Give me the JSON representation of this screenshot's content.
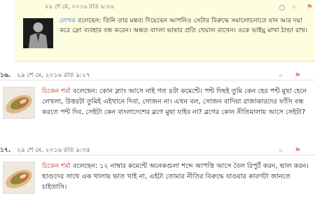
{
  "comments": [
    {
      "date": "২৯ শে মে, ২০১৬ রাত ৯:২৬",
      "author": "লেখক",
      "said": "বলেছেন:",
      "text": "তিনি তার মন্তব্য দিয়েছেন আপনিও সেটার বিরুদ্ধে সমালোচনাতে যান আর দয়া করে স্লেং ব্যবহার বন্ধ করেন। অন্তত বাংলা ভাষার প্রতি খেয়াল রাখেন। ওকে ভাইয়ু মাথা ঠান্ডা রাখ।",
      "votes": "০"
    },
    {
      "num": "১৬.",
      "date": "২৯ শে মে, ২০১৬ রাত ৯:২৭",
      "author": "চিকেন শর্মা",
      "said": "বলেছেন:",
      "text": "কোন স্ল্যাং আসে নাই গত ৪টা কমেন্টে। পন্ট দিছই তুমি কেন হের পন্ট মুছা হেনে লেখলা, উত্তরটা তুমিই এইখানে দিবা, সোজন না। এখন বল, সোজন বাদিয়া রাজাকারদের ফাঁসি বন্ধ করতে পন্ট দিব, সেইটা কেন বাংলাদেশের ব্লগে মুছা যাইব না? ব্লগের কোন নীতিমালায় আসে সেইটা?",
      "votes": "০"
    },
    {
      "num": "১৭.",
      "date": "২৯ শে মে, ২০১৬ রাত ৯:৩৫",
      "author": "চিকেন শর্মা",
      "said": "বলেছেন:",
      "text": "১২ নাম্বার কমেন্টে অনেকগুলা শব্দে আপত্তি আসে বৈল রিপুর্ট করন, ভাল করন। ছাগুদের সাথে এক থালায় ভাত খাই না, এইটা তোমার নীতির বিরুদ্ধে যাওয়ার কারণটা জানতে চাইতাসি।",
      "votes": "০"
    }
  ],
  "icons": {
    "flag": "flag-icon",
    "reply": "reply-icon"
  },
  "colors": {
    "highlight_bg": "#fdfde0",
    "author": "#3a6dbf",
    "commenter": "#c0392b"
  }
}
